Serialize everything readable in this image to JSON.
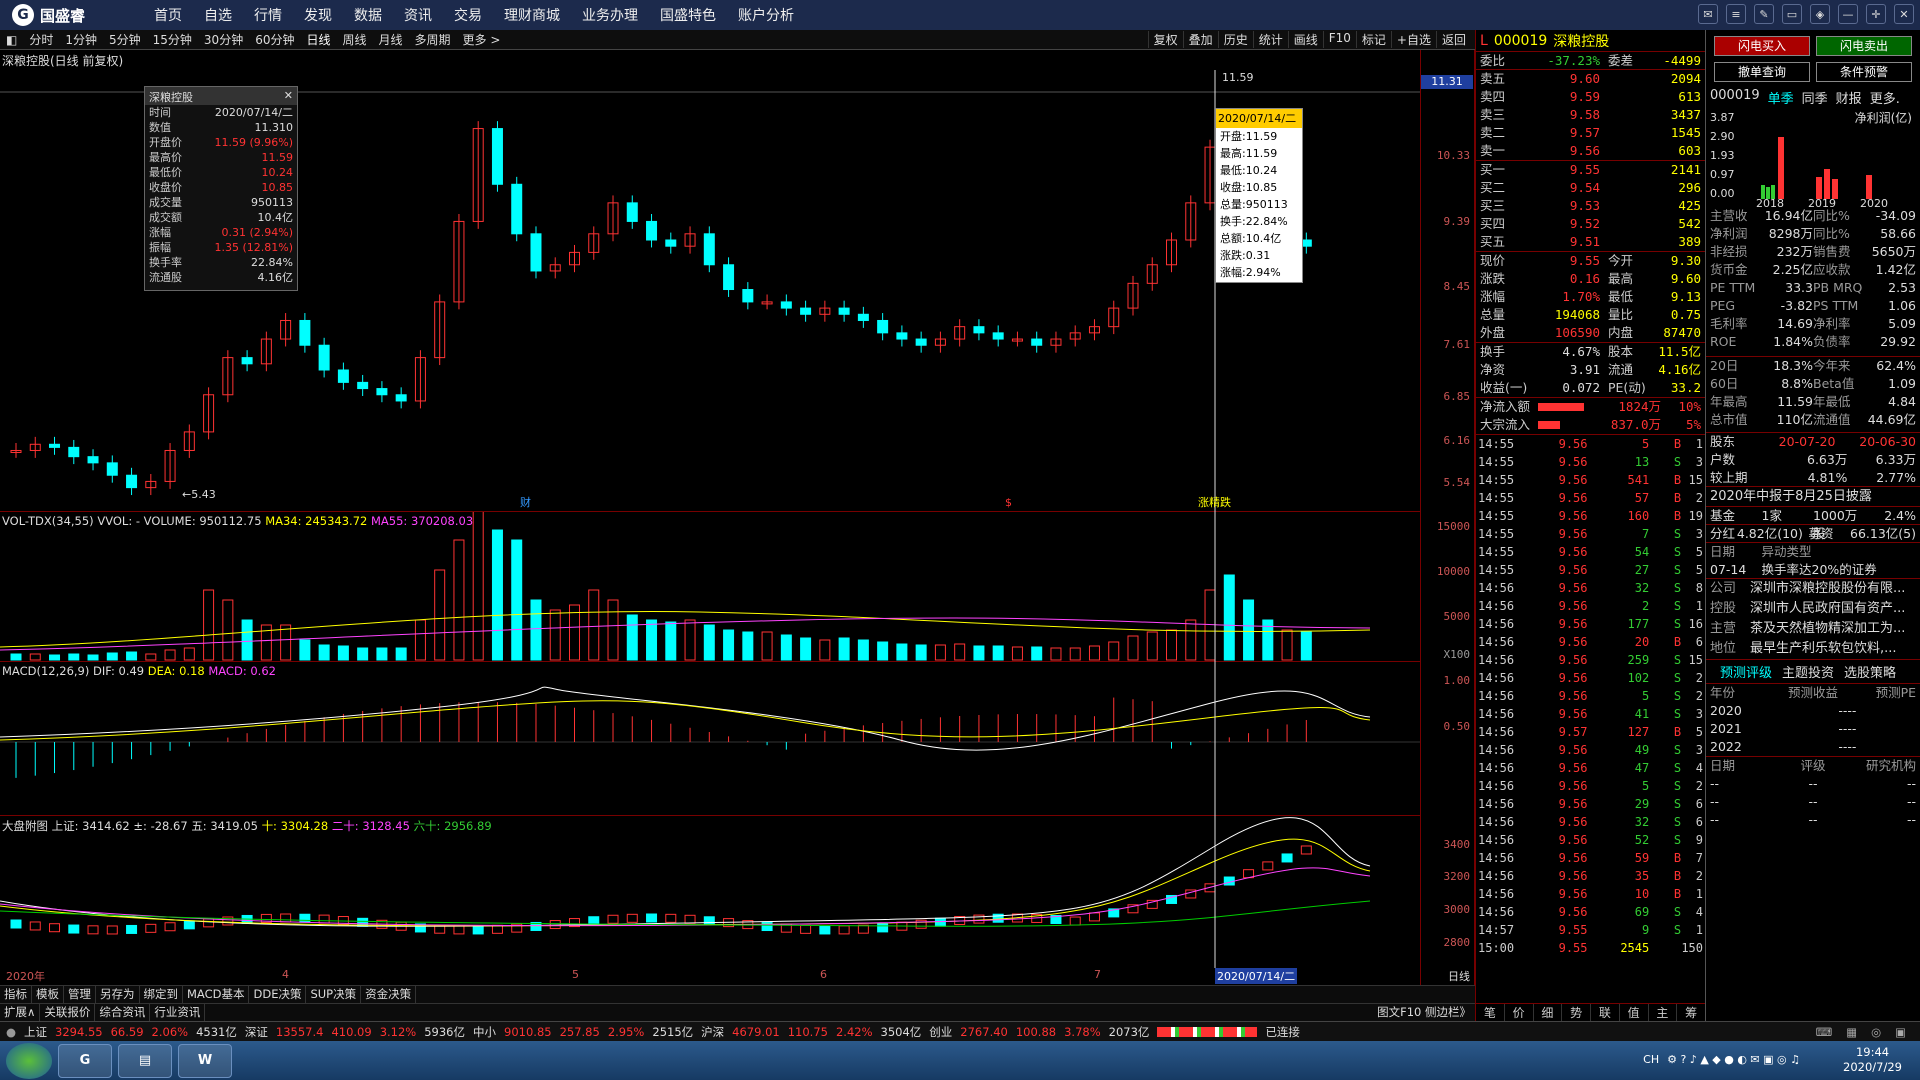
{
  "app": {
    "name": "国盛睿",
    "nav": [
      "首页",
      "自选",
      "行情",
      "发现",
      "数据",
      "资讯",
      "交易",
      "理财商城",
      "业务办理",
      "国盛特色",
      "账户分析"
    ]
  },
  "periods": [
    "分时",
    "1分钟",
    "5分钟",
    "15分钟",
    "30分钟",
    "60分钟",
    "日线",
    "周线",
    "月线",
    "多周期",
    "更多 >"
  ],
  "period_tools": [
    "复权",
    "叠加",
    "历史",
    "统计",
    "画线",
    "F10",
    "标记",
    "+自选",
    "返回"
  ],
  "chart_title": "深粮控股(日线 前复权)",
  "infobox": {
    "title": "深粮控股",
    "rows": [
      [
        "时间",
        "2020/07/14/二"
      ],
      [
        "数值",
        "11.310"
      ],
      [
        "开盘价",
        "11.59 (9.96%)"
      ],
      [
        "最高价",
        "11.59"
      ],
      [
        "最低价",
        "10.24"
      ],
      [
        "收盘价",
        "10.85"
      ],
      [
        "成交量",
        "950113"
      ],
      [
        "成交额",
        "10.4亿"
      ],
      [
        "涨幅",
        "0.31 (2.94%)"
      ],
      [
        "振幅",
        "1.35 (12.81%)"
      ],
      [
        "换手率",
        "22.84%"
      ],
      [
        "流通股",
        "4.16亿"
      ]
    ]
  },
  "tooltip": {
    "date": "2020/07/14/二",
    "rows": [
      "开盘:11.59",
      "最高:11.59",
      "最低:10.24",
      "收盘:10.85",
      "总量:950113",
      "换手:22.84%",
      "总额:10.4亿",
      "涨跌:0.31",
      "涨幅:2.94%"
    ]
  },
  "price_axis": [
    "10.33",
    "9.39",
    "8.45",
    "7.61",
    "6.85",
    "6.16",
    "5.54"
  ],
  "price_current": "11.31",
  "high_label": "11.59",
  "low_label": "5.43",
  "markers": {
    "cai": "财",
    "s": "$",
    "zt": "涨",
    "jg": "精",
    "die": "跌"
  },
  "vol_title": {
    "name": "VOL-TDX(34,55)",
    "vvol": "VVOL: -",
    "volume": "VOLUME: 950112.75",
    "ma34": "MA34: 245343.72",
    "ma55": "MA55: 370208.03"
  },
  "vol_axis": [
    "15000",
    "10000",
    "5000",
    "X100"
  ],
  "macd_title": {
    "name": "MACD(12,26,9)",
    "dif": "DIF: 0.49",
    "dea": "DEA: 0.18",
    "macd": "MACD: 0.62"
  },
  "macd_axis": [
    "1.00",
    "0.50"
  ],
  "idx_title": {
    "name": "大盘附图",
    "sz": "上证: 3414.62",
    "chg": "±: -28.67",
    "w": "五: 3419.05",
    "s": "十: 3304.28",
    "e": "二十: 3128.45",
    "l": "六十: 2956.89"
  },
  "idx_axis": [
    "3400",
    "3200",
    "3000",
    "2800"
  ],
  "xaxis": {
    "y": "2020年",
    "m4": "4",
    "m5": "5",
    "m6": "6",
    "m7": "7",
    "sel": "2020/07/14/二",
    "rlab": "日线"
  },
  "toolbar2": [
    "指标",
    "模板",
    "管理",
    "另存为",
    "绑定到",
    "MACD基本",
    "DDE决策",
    "SUP决策",
    "资金决策"
  ],
  "toolbar3": [
    "扩展∧",
    "关联报价",
    "综合资讯",
    "行业资讯"
  ],
  "toolbar3_right": "图文F10 侧边栏》",
  "right_tabs": [
    "笔",
    "价",
    "细",
    "势",
    "联",
    "值",
    "主",
    "筹"
  ],
  "status": {
    "sh": "上证",
    "sh_v": "3294.55",
    "sh_c": "66.59",
    "sh_p": "2.06%",
    "sh_a": "4531亿",
    "sz": "深证",
    "sz_v": "13557.4",
    "sz_c": "410.09",
    "sz_p": "3.12%",
    "sz_a": "5936亿",
    "zx": "中小",
    "zx_v": "9010.85",
    "zx_c": "257.85",
    "zx_p": "2.95%",
    "zx_a": "2515亿",
    "hs": "沪深",
    "hs_v": "4679.01",
    "hs_c": "110.75",
    "hs_p": "2.42%",
    "hs_a": "3504亿",
    "cy": "创业",
    "cy_v": "2767.40",
    "cy_c": "100.88",
    "cy_p": "3.78%",
    "cy_a": "2073亿",
    "conn": "已连接"
  },
  "clock": {
    "time": "19:44",
    "date": "2020/7/29",
    "lang": "CH"
  },
  "stock": {
    "code": "000019",
    "name": "深粮控股",
    "mark": "L"
  },
  "wb": {
    "wb_l": "委比",
    "wb_v": "-37.23%",
    "wc_l": "委差",
    "wc_v": "-4499"
  },
  "asks": [
    [
      "卖五",
      "9.60",
      "2094"
    ],
    [
      "卖四",
      "9.59",
      "613"
    ],
    [
      "卖三",
      "9.58",
      "3437"
    ],
    [
      "卖二",
      "9.57",
      "1545"
    ],
    [
      "卖一",
      "9.56",
      "603"
    ]
  ],
  "bids": [
    [
      "买一",
      "9.55",
      "2141"
    ],
    [
      "买二",
      "9.54",
      "296"
    ],
    [
      "买三",
      "9.53",
      "425"
    ],
    [
      "买四",
      "9.52",
      "542"
    ],
    [
      "买五",
      "9.51",
      "389"
    ]
  ],
  "quote": [
    [
      "现价",
      "9.55",
      "今开",
      "9.30"
    ],
    [
      "涨跌",
      "0.16",
      "最高",
      "9.60"
    ],
    [
      "涨幅",
      "1.70%",
      "最低",
      "9.13"
    ],
    [
      "总量",
      "194068",
      "量比",
      "0.75"
    ],
    [
      "外盘",
      "106590",
      "内盘",
      "87470"
    ]
  ],
  "quote2": [
    [
      "换手",
      "4.67%",
      "股本",
      "11.5亿"
    ],
    [
      "净资",
      "3.91",
      "流通",
      "4.16亿"
    ],
    [
      "收益(一)",
      "0.072",
      "PE(动)",
      "33.2"
    ]
  ],
  "flow": [
    [
      "净流入额",
      "1824万",
      "10%"
    ],
    [
      "大宗流入",
      "837.0万",
      "5%"
    ]
  ],
  "ticks": [
    [
      "14:55",
      "9.56",
      "5",
      "B",
      "1"
    ],
    [
      "14:55",
      "9.56",
      "13",
      "S",
      "3"
    ],
    [
      "14:55",
      "9.56",
      "541",
      "B",
      "15"
    ],
    [
      "14:55",
      "9.56",
      "57",
      "B",
      "2"
    ],
    [
      "14:55",
      "9.56",
      "160",
      "B",
      "19"
    ],
    [
      "14:55",
      "9.56",
      "7",
      "S",
      "3"
    ],
    [
      "14:55",
      "9.56",
      "54",
      "S",
      "5"
    ],
    [
      "14:55",
      "9.56",
      "27",
      "S",
      "5"
    ],
    [
      "14:56",
      "9.56",
      "32",
      "S",
      "8"
    ],
    [
      "14:56",
      "9.56",
      "2",
      "S",
      "1"
    ],
    [
      "14:56",
      "9.56",
      "177",
      "S",
      "16"
    ],
    [
      "14:56",
      "9.56",
      "20",
      "B",
      "6"
    ],
    [
      "14:56",
      "9.56",
      "259",
      "S",
      "15"
    ],
    [
      "14:56",
      "9.56",
      "102",
      "S",
      "2"
    ],
    [
      "14:56",
      "9.56",
      "5",
      "S",
      "2"
    ],
    [
      "14:56",
      "9.56",
      "41",
      "S",
      "3"
    ],
    [
      "14:56",
      "9.57",
      "127",
      "B",
      "5"
    ],
    [
      "14:56",
      "9.56",
      "49",
      "S",
      "3"
    ],
    [
      "14:56",
      "9.56",
      "47",
      "S",
      "4"
    ],
    [
      "14:56",
      "9.56",
      "5",
      "S",
      "2"
    ],
    [
      "14:56",
      "9.56",
      "29",
      "S",
      "6"
    ],
    [
      "14:56",
      "9.56",
      "32",
      "S",
      "6"
    ],
    [
      "14:56",
      "9.56",
      "52",
      "S",
      "9"
    ],
    [
      "14:56",
      "9.56",
      "59",
      "B",
      "7"
    ],
    [
      "14:56",
      "9.56",
      "35",
      "B",
      "2"
    ],
    [
      "14:56",
      "9.56",
      "10",
      "B",
      "1"
    ],
    [
      "14:56",
      "9.56",
      "69",
      "S",
      "4"
    ],
    [
      "14:57",
      "9.55",
      "9",
      "S",
      "1"
    ],
    [
      "15:00",
      "9.55",
      "2545",
      "",
      "150"
    ]
  ],
  "r2": {
    "btn_buy": "闪电买入",
    "btn_sell": "闪电卖出",
    "btn_cancel": "撤单查询",
    "btn_cond": "条件预警",
    "code": "000019",
    "tabs": [
      "单季",
      "同季",
      "财报",
      "更多."
    ],
    "chart_title": "净利润(亿)",
    "chart_y": [
      "3.87",
      "2.90",
      "1.93",
      "0.97",
      "0.00"
    ],
    "chart_x": [
      "2018",
      "2019",
      "2020"
    ],
    "fin": [
      [
        "主营收",
        "16.94亿",
        "同比%",
        "-34.09"
      ],
      [
        "净利润",
        "8298万",
        "同比%",
        "58.66"
      ],
      [
        "非经损",
        "232万",
        "销售费",
        "5650万"
      ],
      [
        "货币金",
        "2.25亿",
        "应收款",
        "1.42亿"
      ],
      [
        "PE TTM",
        "33.3",
        "PB MRQ",
        "2.53"
      ],
      [
        "PEG",
        "-3.82",
        "PS TTM",
        "1.06"
      ],
      [
        "毛利率",
        "14.69",
        "净利率",
        "5.09"
      ],
      [
        "ROE",
        "1.84%",
        "负债率",
        "29.92"
      ]
    ],
    "perf": [
      [
        "20日",
        "18.3%",
        "今年来",
        "62.4%"
      ],
      [
        "60日",
        "8.8%",
        "Beta值",
        "1.09"
      ],
      [
        "年最高",
        "11.59",
        "年最低",
        "4.84"
      ],
      [
        "总市值",
        "110亿",
        "流通值",
        "44.69亿"
      ]
    ],
    "holders": {
      "k": "股东",
      "d1": "20-07-20",
      "d2": "20-06-30",
      "r1k": "户数",
      "r1a": "6.63万",
      "r1b": "6.33万",
      "r2k": "较上期",
      "r2a": "4.81%",
      "r2b": "2.77%"
    },
    "notice": "2020年中报于8月25日披露",
    "fund": [
      "基金",
      "1家",
      "1000万股",
      "2.4%"
    ],
    "div": [
      "分红",
      "4.82亿(10)",
      "募资",
      "66.13亿(5)"
    ],
    "abn": {
      "h1": "日期",
      "h2": "异动类型",
      "d": "07-14",
      "t": "换手率达20%的证券"
    },
    "co": [
      [
        "公司",
        "深圳市深粮控股股份有限..."
      ],
      [
        "控股",
        "深圳市人民政府国有资产..."
      ],
      [
        "主营",
        "茶及天然植物精深加工为..."
      ],
      [
        "地位",
        "最早生产利乐软包饮料,..."
      ]
    ],
    "tabs2": [
      "预测评级",
      "主题投资",
      "选股策略"
    ],
    "fc_head": [
      "年份",
      "预测收益",
      "预测PE"
    ],
    "fc": [
      [
        "2020",
        "--",
        "--"
      ],
      [
        "2021",
        "--",
        "--"
      ],
      [
        "2022",
        "--",
        "--"
      ]
    ],
    "rt_head": [
      "日期",
      "评级",
      "研究机构"
    ]
  },
  "colors": {
    "up": "#ff3333",
    "down": "#00ffff",
    "ma5": "#ffffff",
    "ma10": "#ffff00",
    "ma20": "#ff44ff",
    "ma60": "#00cc00"
  }
}
